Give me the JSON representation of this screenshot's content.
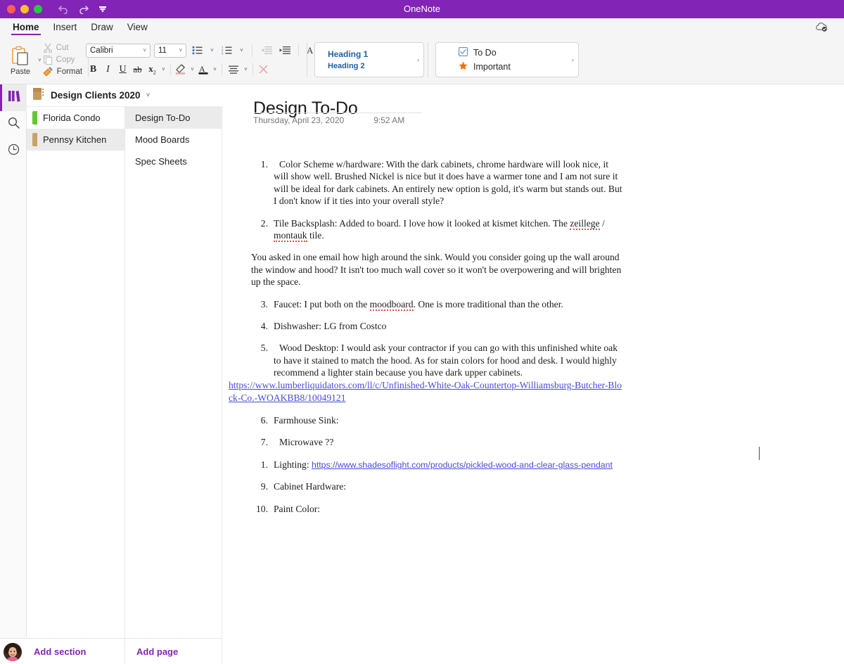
{
  "window": {
    "title": "OneNote",
    "traffic_lights": [
      "close",
      "minimize",
      "maximize"
    ],
    "quick_access": [
      "undo-icon",
      "redo-icon",
      "customize-toolbar-icon"
    ],
    "sync_icon": "cloud-sync-icon"
  },
  "tabs": [
    {
      "label": "Home",
      "active": true
    },
    {
      "label": "Insert",
      "active": false
    },
    {
      "label": "Draw",
      "active": false
    },
    {
      "label": "View",
      "active": false
    }
  ],
  "ribbon": {
    "clipboard": {
      "paste_label": "Paste",
      "cut_label": "Cut",
      "copy_label": "Copy",
      "format_label": "Format"
    },
    "font": {
      "family": "Calibri",
      "size": "11",
      "buttons": [
        "bullet-list-icon",
        "numbered-list-icon",
        "decrease-indent-icon",
        "increase-indent-icon",
        "clear-formatting-icon",
        "bold-icon",
        "italic-icon",
        "underline-icon",
        "strikethrough-icon",
        "subscript-icon",
        "highlight-icon",
        "font-color-icon",
        "align-icon",
        "delete-icon"
      ]
    },
    "styles": {
      "heading1": "Heading 1",
      "heading2": "Heading 2",
      "expand": "›"
    },
    "tags": {
      "todo": "To Do",
      "important": "Important",
      "expand": "›",
      "todo_icon": "checkbox-icon",
      "important_icon": "star-icon",
      "star_color": "#f07010"
    }
  },
  "rail": {
    "items": [
      {
        "name": "notebooks-icon",
        "active": true
      },
      {
        "name": "search-icon",
        "active": false
      },
      {
        "name": "recent-icon",
        "active": false
      }
    ]
  },
  "notebook": {
    "name": "Design Clients 2020",
    "chevron": "⌄"
  },
  "sections": [
    {
      "label": "Florida Condo",
      "color": "#5ec92b",
      "selected": false
    },
    {
      "label": "Pennsy Kitchen",
      "color": "#c9a268",
      "selected": true
    }
  ],
  "pages": [
    {
      "label": "Design To-Do",
      "selected": true
    },
    {
      "label": "Mood Boards",
      "selected": false
    },
    {
      "label": "Spec Sheets",
      "selected": false
    }
  ],
  "bottom": {
    "add_section": "Add section",
    "add_page": "Add page",
    "avatar": "user-avatar"
  },
  "page": {
    "title": "Design To-Do",
    "date": "Thursday, April 23, 2020",
    "time": "9:52 AM",
    "items": [
      {
        "num": "1.",
        "text": "Color Scheme w/hardware: With the dark cabinets, chrome hardware will look nice, it will show well. Brushed Nickel is nice but it does have a warmer tone and I am not sure it will be ideal for dark cabinets. An entirely new option is gold, it's warm but stands out. But I don't know if it ties into your overall style?"
      },
      {
        "num": "2.",
        "text_before": "Tile Backsplash: Added to board. I love how it looked at kismet kitchen. The ",
        "misspelled1": "zeillege",
        "text_mid": " / ",
        "misspelled2": "montauk",
        "text_after": " tile."
      },
      {
        "num": "3.",
        "text_before": "Faucet: I put both on the ",
        "misspelled1": "moodboard",
        "text_after": ". One is more traditional than the other."
      },
      {
        "num": "4.",
        "text": "Dishwasher: LG from Costco"
      },
      {
        "num": "5.",
        "text": "Wood Desktop: I would ask your contractor if you can go with this unfinished white oak to have it stained to match the hood. As for stain colors for hood and desk. I would highly recommend a lighter stain because you have dark upper cabinets.",
        "link": "https://www.lumberliquidators.com/ll/c/Unfinished-White-Oak-Countertop-Williamsburg-Butcher-Block-Co.-WOAKBB8/10049121"
      },
      {
        "num": "6.",
        "text": "Farmhouse Sink:"
      },
      {
        "num": "7.",
        "text": "Microwave ??"
      },
      {
        "num": "1.",
        "text_before": "Lighting: ",
        "link": "https://www.shadesoflight.com/products/pickled-wood-and-clear-glass-pendant"
      },
      {
        "num": "9.",
        "text": "Cabinet Hardware:"
      },
      {
        "num": "10.",
        "text": "Paint Color:"
      }
    ],
    "paragraph": "You asked in one email how high around the sink. Would you consider going up the wall around the window and hood? It isn't too much wall cover so it won't be overpowering and will brighten up the space."
  },
  "colors": {
    "brand_purple": "#8224b5",
    "link_blue": "#4b4bd6",
    "style_blue": "#1f5fa9"
  }
}
